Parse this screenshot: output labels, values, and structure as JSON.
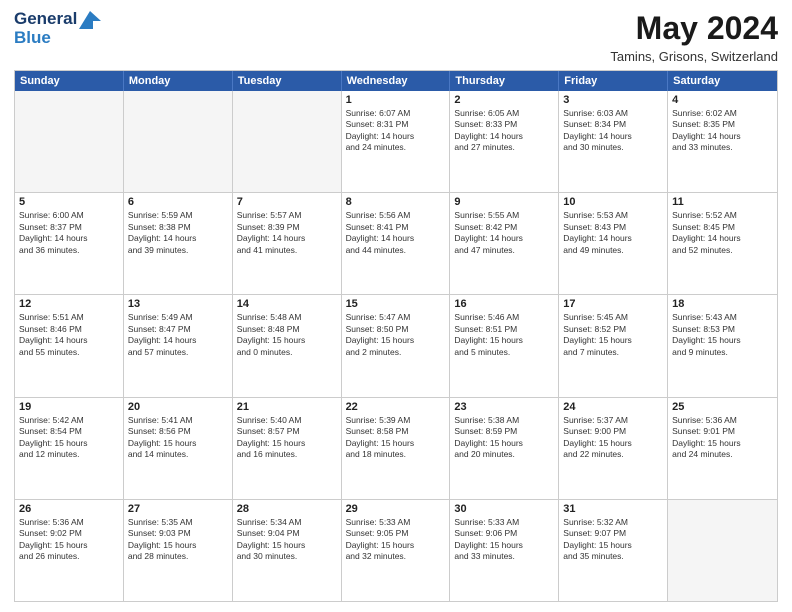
{
  "header": {
    "logo_line1": "General",
    "logo_line2": "Blue",
    "month": "May 2024",
    "location": "Tamins, Grisons, Switzerland"
  },
  "weekdays": [
    "Sunday",
    "Monday",
    "Tuesday",
    "Wednesday",
    "Thursday",
    "Friday",
    "Saturday"
  ],
  "weeks": [
    [
      {
        "day": "",
        "info": ""
      },
      {
        "day": "",
        "info": ""
      },
      {
        "day": "",
        "info": ""
      },
      {
        "day": "1",
        "info": "Sunrise: 6:07 AM\nSunset: 8:31 PM\nDaylight: 14 hours\nand 24 minutes."
      },
      {
        "day": "2",
        "info": "Sunrise: 6:05 AM\nSunset: 8:33 PM\nDaylight: 14 hours\nand 27 minutes."
      },
      {
        "day": "3",
        "info": "Sunrise: 6:03 AM\nSunset: 8:34 PM\nDaylight: 14 hours\nand 30 minutes."
      },
      {
        "day": "4",
        "info": "Sunrise: 6:02 AM\nSunset: 8:35 PM\nDaylight: 14 hours\nand 33 minutes."
      }
    ],
    [
      {
        "day": "5",
        "info": "Sunrise: 6:00 AM\nSunset: 8:37 PM\nDaylight: 14 hours\nand 36 minutes."
      },
      {
        "day": "6",
        "info": "Sunrise: 5:59 AM\nSunset: 8:38 PM\nDaylight: 14 hours\nand 39 minutes."
      },
      {
        "day": "7",
        "info": "Sunrise: 5:57 AM\nSunset: 8:39 PM\nDaylight: 14 hours\nand 41 minutes."
      },
      {
        "day": "8",
        "info": "Sunrise: 5:56 AM\nSunset: 8:41 PM\nDaylight: 14 hours\nand 44 minutes."
      },
      {
        "day": "9",
        "info": "Sunrise: 5:55 AM\nSunset: 8:42 PM\nDaylight: 14 hours\nand 47 minutes."
      },
      {
        "day": "10",
        "info": "Sunrise: 5:53 AM\nSunset: 8:43 PM\nDaylight: 14 hours\nand 49 minutes."
      },
      {
        "day": "11",
        "info": "Sunrise: 5:52 AM\nSunset: 8:45 PM\nDaylight: 14 hours\nand 52 minutes."
      }
    ],
    [
      {
        "day": "12",
        "info": "Sunrise: 5:51 AM\nSunset: 8:46 PM\nDaylight: 14 hours\nand 55 minutes."
      },
      {
        "day": "13",
        "info": "Sunrise: 5:49 AM\nSunset: 8:47 PM\nDaylight: 14 hours\nand 57 minutes."
      },
      {
        "day": "14",
        "info": "Sunrise: 5:48 AM\nSunset: 8:48 PM\nDaylight: 15 hours\nand 0 minutes."
      },
      {
        "day": "15",
        "info": "Sunrise: 5:47 AM\nSunset: 8:50 PM\nDaylight: 15 hours\nand 2 minutes."
      },
      {
        "day": "16",
        "info": "Sunrise: 5:46 AM\nSunset: 8:51 PM\nDaylight: 15 hours\nand 5 minutes."
      },
      {
        "day": "17",
        "info": "Sunrise: 5:45 AM\nSunset: 8:52 PM\nDaylight: 15 hours\nand 7 minutes."
      },
      {
        "day": "18",
        "info": "Sunrise: 5:43 AM\nSunset: 8:53 PM\nDaylight: 15 hours\nand 9 minutes."
      }
    ],
    [
      {
        "day": "19",
        "info": "Sunrise: 5:42 AM\nSunset: 8:54 PM\nDaylight: 15 hours\nand 12 minutes."
      },
      {
        "day": "20",
        "info": "Sunrise: 5:41 AM\nSunset: 8:56 PM\nDaylight: 15 hours\nand 14 minutes."
      },
      {
        "day": "21",
        "info": "Sunrise: 5:40 AM\nSunset: 8:57 PM\nDaylight: 15 hours\nand 16 minutes."
      },
      {
        "day": "22",
        "info": "Sunrise: 5:39 AM\nSunset: 8:58 PM\nDaylight: 15 hours\nand 18 minutes."
      },
      {
        "day": "23",
        "info": "Sunrise: 5:38 AM\nSunset: 8:59 PM\nDaylight: 15 hours\nand 20 minutes."
      },
      {
        "day": "24",
        "info": "Sunrise: 5:37 AM\nSunset: 9:00 PM\nDaylight: 15 hours\nand 22 minutes."
      },
      {
        "day": "25",
        "info": "Sunrise: 5:36 AM\nSunset: 9:01 PM\nDaylight: 15 hours\nand 24 minutes."
      }
    ],
    [
      {
        "day": "26",
        "info": "Sunrise: 5:36 AM\nSunset: 9:02 PM\nDaylight: 15 hours\nand 26 minutes."
      },
      {
        "day": "27",
        "info": "Sunrise: 5:35 AM\nSunset: 9:03 PM\nDaylight: 15 hours\nand 28 minutes."
      },
      {
        "day": "28",
        "info": "Sunrise: 5:34 AM\nSunset: 9:04 PM\nDaylight: 15 hours\nand 30 minutes."
      },
      {
        "day": "29",
        "info": "Sunrise: 5:33 AM\nSunset: 9:05 PM\nDaylight: 15 hours\nand 32 minutes."
      },
      {
        "day": "30",
        "info": "Sunrise: 5:33 AM\nSunset: 9:06 PM\nDaylight: 15 hours\nand 33 minutes."
      },
      {
        "day": "31",
        "info": "Sunrise: 5:32 AM\nSunset: 9:07 PM\nDaylight: 15 hours\nand 35 minutes."
      },
      {
        "day": "",
        "info": ""
      }
    ]
  ]
}
